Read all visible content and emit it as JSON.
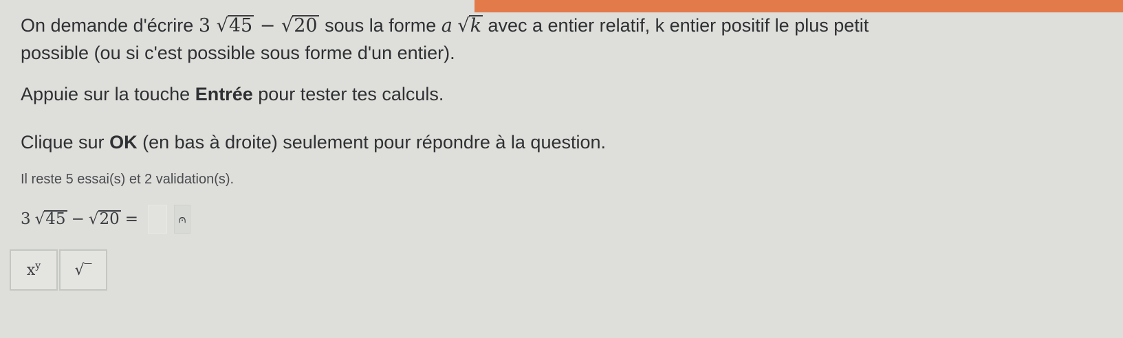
{
  "instructions": {
    "line1_prefix": "On demande d'écrire",
    "expr_coef": "3",
    "expr_rad1": "45",
    "expr_minus": "−",
    "expr_rad2": "20",
    "line1_mid": "sous la forme",
    "var_a": "a",
    "var_k": "k",
    "line1_suffix": "avec a entier relatif, k entier positif le plus petit",
    "line2": "possible (ou si c'est possible sous forme d'un entier).",
    "enter_prefix": "Appuie sur la touche",
    "enter_key": "Entrée",
    "enter_suffix": "pour tester tes calculs.",
    "ok_prefix": "Clique sur",
    "ok_key": "OK",
    "ok_suffix": "(en bas à droite) seulement pour répondre à la question."
  },
  "attempts": "Il reste 5 essai(s) et 2 validation(s).",
  "equation": {
    "coef": "3",
    "rad1": "45",
    "minus": "−",
    "rad2": "20",
    "equals": "=",
    "answer_value": "",
    "feedback_symbol": "⩀"
  },
  "keypad": {
    "power_base": "x",
    "power_exp": "y",
    "sqrt_label": "√‾"
  },
  "colors": {
    "background": "#dedfda",
    "accent_strip": "#e27a4a",
    "text": "#2e3033"
  }
}
